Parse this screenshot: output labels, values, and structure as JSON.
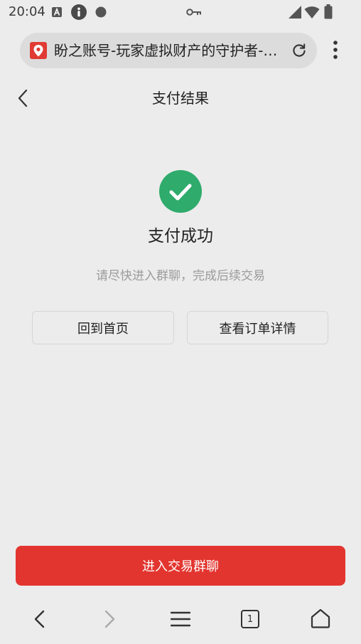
{
  "status_bar": {
    "time": "20:04",
    "icons": [
      "a-square-icon",
      "info-icon",
      "dot-icon",
      "key-icon",
      "signal-icon",
      "wifi-icon",
      "battery-icon"
    ]
  },
  "browser": {
    "url_title": "盼之账号-玩家虚拟财产的守护者-…",
    "icons": [
      "favicon-pin-icon",
      "reload-icon",
      "more-vert-icon"
    ]
  },
  "header": {
    "title": "支付结果",
    "back_icon": "chevron-left-icon"
  },
  "result": {
    "icon": "check-circle-icon",
    "title": "支付成功",
    "subtitle": "请尽快进入群聊，完成后续交易"
  },
  "actions": {
    "home_label": "回到首页",
    "order_label": "查看订单详情"
  },
  "primary": {
    "label": "进入交易群聊"
  },
  "nav": {
    "tab_count": "1",
    "icons": [
      "back-arrow-icon",
      "forward-arrow-icon",
      "menu-icon",
      "tabs-icon",
      "home-icon"
    ]
  },
  "colors": {
    "background": "#ececec",
    "accent": "#e3352f",
    "success": "#2fab6c",
    "url_bar": "#dcdcdc"
  }
}
